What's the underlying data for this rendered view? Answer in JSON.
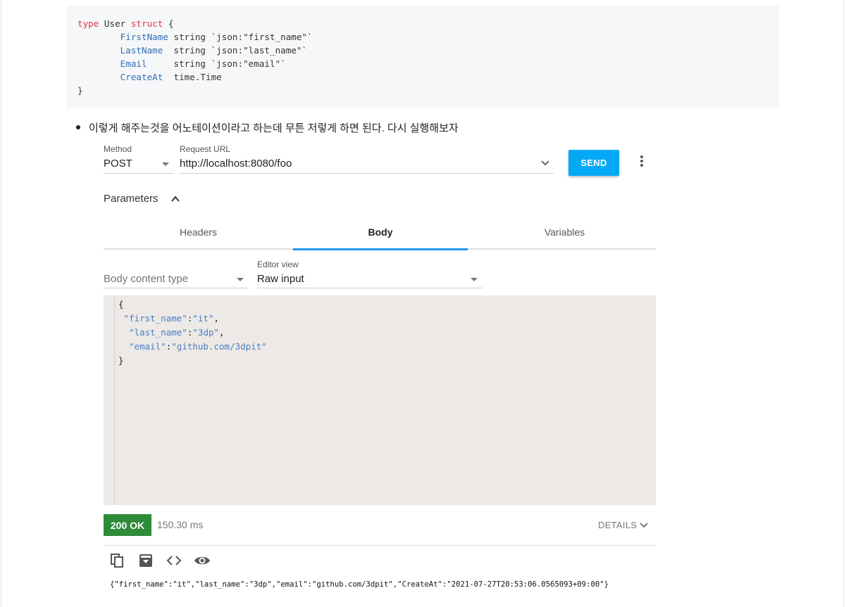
{
  "code": {
    "lines": [
      {
        "kw": "type",
        "rest": " User ",
        "kw2": "struct",
        "tail": " {"
      },
      {
        "indent": "        ",
        "field": "FirstName",
        "tail": " string `json:\"first_name\"`"
      },
      {
        "indent": "        ",
        "field": "LastName",
        "tail": "  string `json:\"last_name\"`"
      },
      {
        "indent": "        ",
        "field": "Email",
        "tail": "     string `json:\"email\"`"
      },
      {
        "indent": "        ",
        "field": "CreateAt",
        "tail": "  time.Time"
      },
      {
        "tail": "}"
      }
    ]
  },
  "bullet": "이렇게 해주는것을 어노테이션이라고 하는데 무튼 저렇게 하면 된다. 다시 실행해보자",
  "request": {
    "method_label": "Method",
    "method_value": "POST",
    "url_label": "Request URL",
    "url_value": "http://localhost:8080/foo",
    "send_label": "SEND"
  },
  "parameters_label": "Parameters",
  "tabs": [
    "Headers",
    "Body",
    "Variables"
  ],
  "active_tab": "Body",
  "body": {
    "content_type_placeholder": "Body content type",
    "editor_view_label": "Editor view",
    "editor_view_value": "Raw input",
    "editor_lines": [
      {
        "pre": "{"
      },
      {
        "pre": " ",
        "key": "\"first_name\"",
        "sep": ":",
        "val": "\"it\"",
        "post": ","
      },
      {
        "pre": "  ",
        "key": "\"last_name\"",
        "sep": ":",
        "val": "\"3dp\"",
        "post": ","
      },
      {
        "pre": "  ",
        "key": "\"email\"",
        "sep": ":",
        "val": "\"github.com/3dpit\"",
        "post": ""
      },
      {
        "pre": "}"
      }
    ]
  },
  "response": {
    "status": "200 OK",
    "time": "150.30 ms",
    "details_label": "DETAILS",
    "body": "{\"first_name\":\"it\",\"last_name\":\"3dp\",\"email\":\"github.com/3dpit\",\"CreateAt\":\"2021-07-27T20:53:06.0565093+09:00\"}"
  },
  "icons": [
    "copy-icon",
    "save-icon",
    "code-icon",
    "eye-icon"
  ],
  "colors": {
    "send": "#03a9f4",
    "status_ok": "#2e8b3a",
    "tab_indicator": "#2196f3",
    "code_keyword": "#d73a49",
    "code_field": "#2f6fb7"
  }
}
